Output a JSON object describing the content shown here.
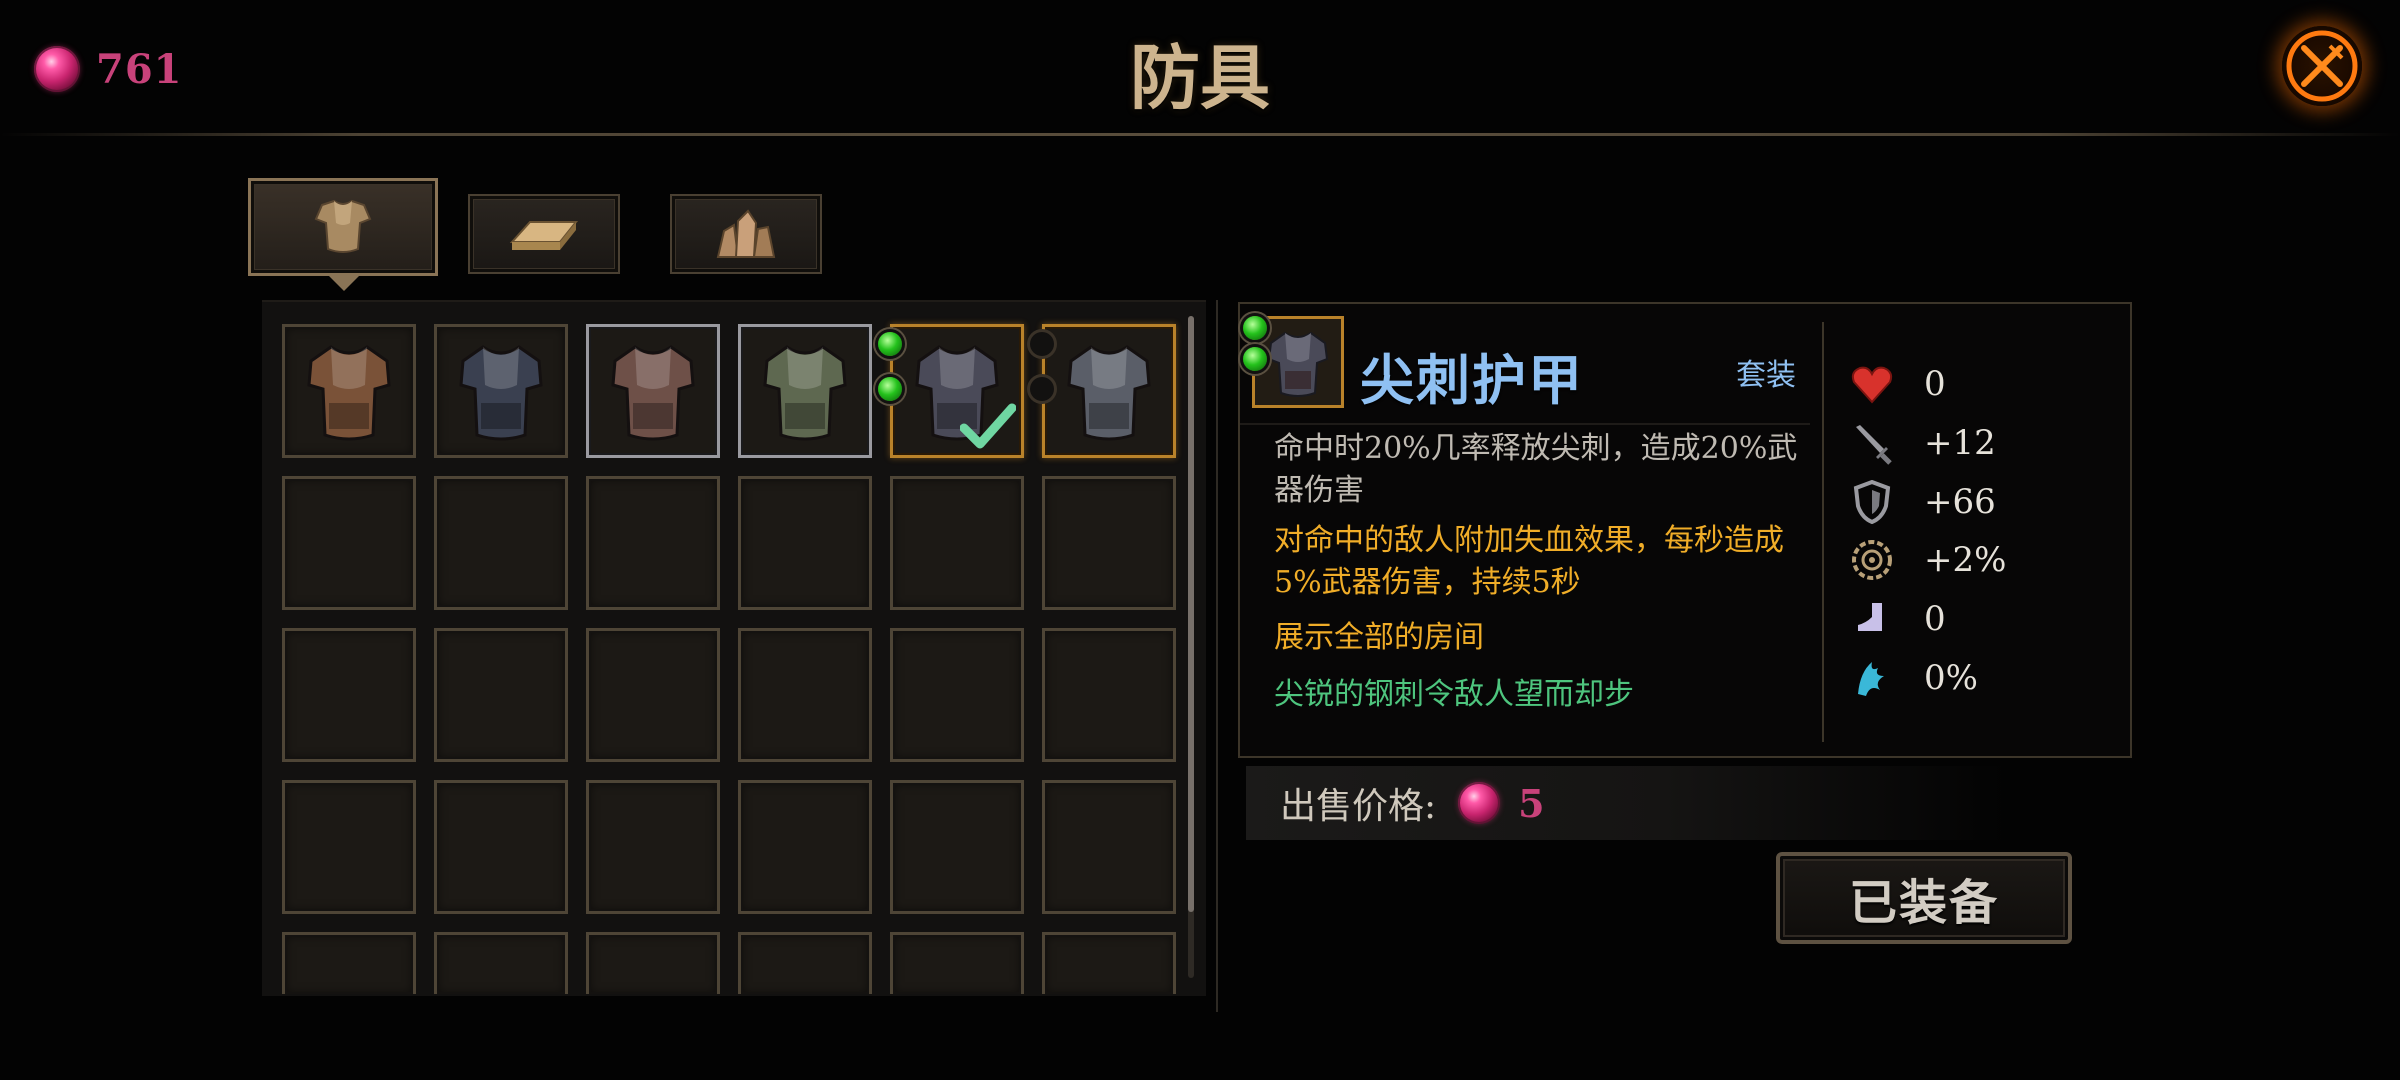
{
  "header": {
    "title": "防具",
    "currency_amount": "761",
    "currency_icon": "soul-gem-icon",
    "close_icon": "crossed-swords-close-icon",
    "accent_color": "#c8427a"
  },
  "tabs": [
    {
      "name": "armor",
      "icon": "chest-armor-icon",
      "active": true
    },
    {
      "name": "ingots",
      "icon": "metal-ingot-icon",
      "active": false
    },
    {
      "name": "crystals",
      "icon": "ore-crystal-icon",
      "active": false
    }
  ],
  "inventory": {
    "columns": 6,
    "visible_rows": 5,
    "items": [
      {
        "icon": "leather-armor-icon",
        "frame": "common",
        "color": "#7a5238"
      },
      {
        "icon": "dark-cloth-armor-icon",
        "frame": "common",
        "color": "#3a4050"
      },
      {
        "icon": "plate-skirt-armor-icon",
        "frame": "silver",
        "color": "#6e5048"
      },
      {
        "icon": "olive-plate-armor-icon",
        "frame": "silver",
        "color": "#5e6850"
      },
      {
        "icon": "spiked-armor-icon",
        "frame": "gold",
        "color": "#4a4a58",
        "sockets": 2,
        "equipped": true
      },
      {
        "icon": "steel-plate-armor-icon",
        "frame": "gold",
        "color": "#5a5e68",
        "empty_sockets": 2
      }
    ]
  },
  "detail": {
    "name": "尖刺护甲",
    "set_label": "套装",
    "icon": "spiked-armor-icon",
    "desc_line1": "命中时20%几率释放尖刺，造成20%武器伤害",
    "desc_line2": "对命中的敌人附加失血效果，每秒造成5%武器伤害，持续5秒",
    "desc_line3": "展示全部的房间",
    "flavor": "尖锐的钢刺令敌人望而却步",
    "name_color": "#8fc0f2",
    "effect_color": "#f0ad28",
    "flavor_color": "#4ec57e"
  },
  "stats": [
    {
      "icon": "heart-icon",
      "value": "0"
    },
    {
      "icon": "sword-icon",
      "value": "+12"
    },
    {
      "icon": "shield-icon",
      "value": "+66"
    },
    {
      "icon": "gear-crit-icon",
      "value": "+2%"
    },
    {
      "icon": "boot-icon",
      "value": "0"
    },
    {
      "icon": "cyan-claw-icon",
      "value": "0%"
    }
  ],
  "price": {
    "label": "出售价格:",
    "value": "5"
  },
  "equipped_button": "已装备"
}
